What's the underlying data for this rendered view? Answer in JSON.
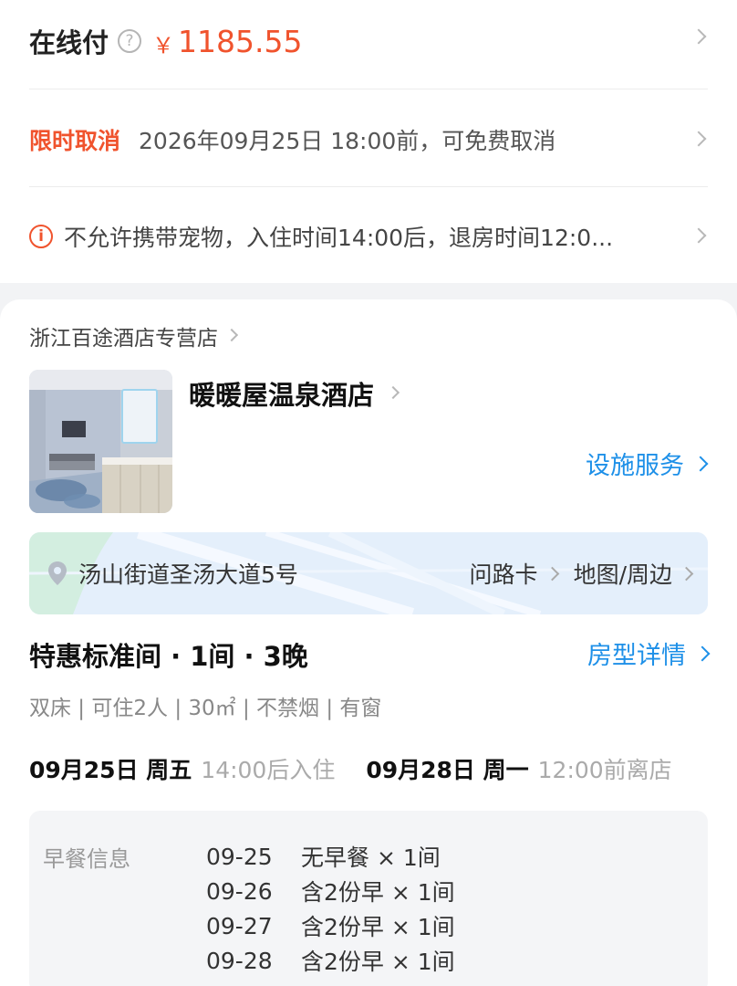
{
  "payment": {
    "label": "在线付",
    "help_icon": "question-circle-icon",
    "currency": "￥",
    "amount": "1185.55"
  },
  "cancellation": {
    "tag": "限时取消",
    "text": "2026年09月25日 18:00前，可免费取消"
  },
  "policy": {
    "icon": "info-circle-icon",
    "text": "不允许携带宠物，入住时间14:00后，退房时间12:0..."
  },
  "shop": {
    "name": "浙江百途酒店专营店"
  },
  "hotel": {
    "name": "暖暖屋温泉酒店",
    "facilities_link": "设施服务"
  },
  "location": {
    "address": "汤山街道圣汤大道5号",
    "route_card": "问路卡",
    "map_link": "地图/周边"
  },
  "room": {
    "title": "特惠标准间 · 1间 · 3晚",
    "detail_link": "房型详情",
    "attributes": "双床 | 可住2人 | 30㎡ | 不禁烟 | 有窗"
  },
  "stay": {
    "checkin_date": "09月25日 周五",
    "checkin_note": "14:00后入住",
    "checkout_date": "09月28日 周一",
    "checkout_note": "12:00前离店"
  },
  "breakfast": {
    "label": "早餐信息",
    "rows": [
      {
        "date": "09-25",
        "desc": "无早餐 × 1间"
      },
      {
        "date": "09-26",
        "desc": "含2份早 × 1间"
      },
      {
        "date": "09-27",
        "desc": "含2份早 × 1间"
      },
      {
        "date": "09-28",
        "desc": "含2份早 × 1间"
      }
    ]
  },
  "colors": {
    "accent_orange": "#f0532d",
    "link_blue": "#1e90e8",
    "page_bg": "#f2f3f5"
  }
}
